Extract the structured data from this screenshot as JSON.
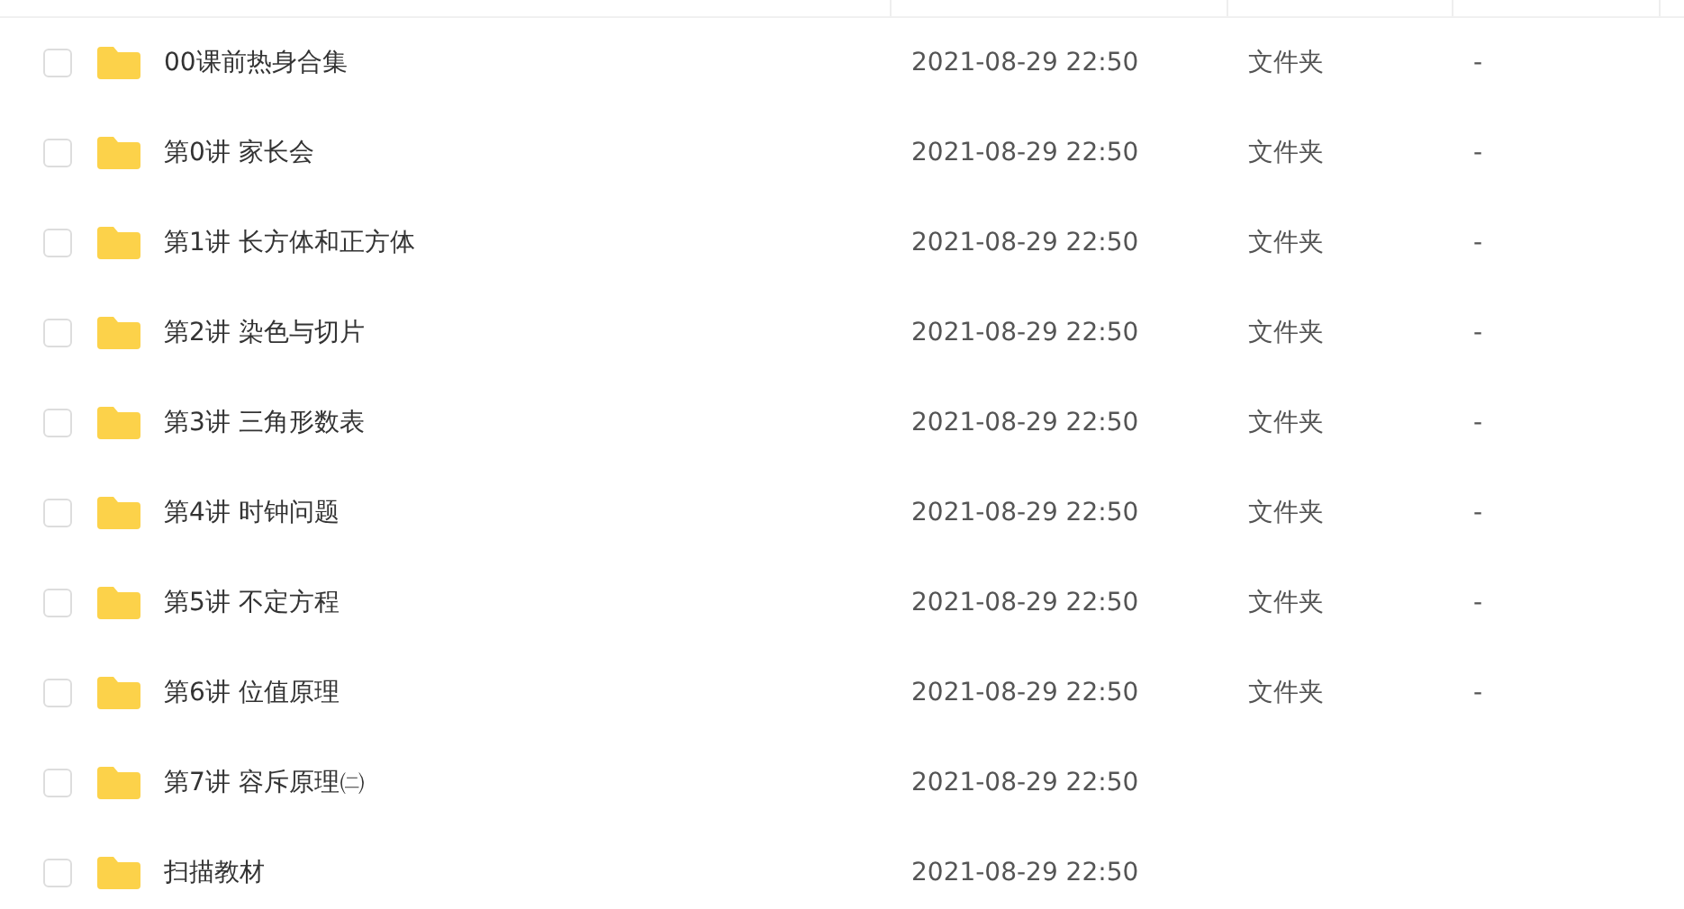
{
  "rows": [
    {
      "name": "00课前热身合集",
      "date": "2021-08-29 22:50",
      "type": "文件夹",
      "size": "-",
      "checked": false
    },
    {
      "name": "第0讲 家长会",
      "date": "2021-08-29 22:50",
      "type": "文件夹",
      "size": "-",
      "checked": false
    },
    {
      "name": "第1讲 长方体和正方体",
      "date": "2021-08-29 22:50",
      "type": "文件夹",
      "size": "-",
      "checked": false
    },
    {
      "name": "第2讲 染色与切片",
      "date": "2021-08-29 22:50",
      "type": "文件夹",
      "size": "-",
      "checked": false
    },
    {
      "name": "第3讲 三角形数表",
      "date": "2021-08-29 22:50",
      "type": "文件夹",
      "size": "-",
      "checked": false
    },
    {
      "name": "第4讲 时钟问题",
      "date": "2021-08-29 22:50",
      "type": "文件夹",
      "size": "-",
      "checked": false
    },
    {
      "name": "第5讲 不定方程",
      "date": "2021-08-29 22:50",
      "type": "文件夹",
      "size": "-",
      "checked": false
    },
    {
      "name": "第6讲 位值原理",
      "date": "2021-08-29 22:50",
      "type": "文件夹",
      "size": "-",
      "checked": false
    },
    {
      "name": "第7讲 容斥原理㈡",
      "date": "2021-08-29 22:50",
      "checked": false
    },
    {
      "name": "扫描教材",
      "date": "2021-08-29 22:50",
      "checked": false
    }
  ]
}
